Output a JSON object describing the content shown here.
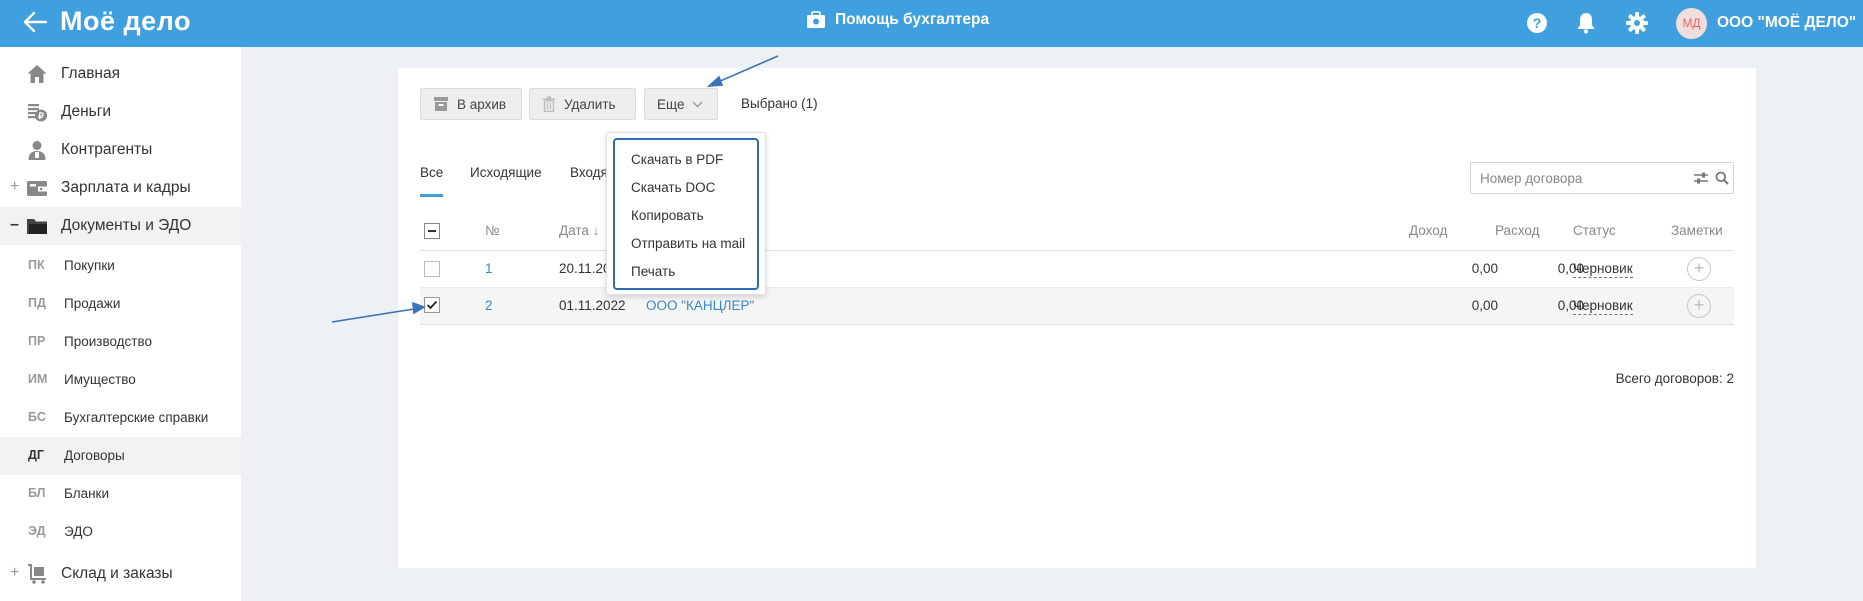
{
  "header": {
    "logo": "Моё дело",
    "help_center": "Помощь бухгалтера",
    "avatar_initials": "МД",
    "org_name": "ООО \"МОЁ ДЕЛО\""
  },
  "sidebar": {
    "items": [
      {
        "label": "Главная",
        "sign": ""
      },
      {
        "label": "Деньги",
        "sign": ""
      },
      {
        "label": "Контрагенты",
        "sign": ""
      },
      {
        "label": "Зарплата и кадры",
        "sign": "+"
      },
      {
        "label": "Документы и ЭДО",
        "sign": "–"
      },
      {
        "label": "Склад и заказы",
        "sign": "+"
      }
    ],
    "subitems": [
      {
        "abbr": "ПК",
        "label": "Покупки"
      },
      {
        "abbr": "ПД",
        "label": "Продажи"
      },
      {
        "abbr": "ПР",
        "label": "Производство"
      },
      {
        "abbr": "ИМ",
        "label": "Имущество"
      },
      {
        "abbr": "БС",
        "label": "Бухгалтерские справки"
      },
      {
        "abbr": "ДГ",
        "label": "Договоры"
      },
      {
        "abbr": "БЛ",
        "label": "Бланки"
      },
      {
        "abbr": "ЭД",
        "label": "ЭДО"
      }
    ]
  },
  "toolbar": {
    "archive_label": "В архив",
    "delete_label": "Удалить",
    "more_label": "Еще",
    "selected_text": "Выбрано (1)"
  },
  "tabs": [
    {
      "label": "Все"
    },
    {
      "label": "Исходящие"
    },
    {
      "label": "Входя"
    }
  ],
  "search": {
    "placeholder": "Номер договора"
  },
  "table": {
    "columns": {
      "number": "№",
      "date": "Дата ↓",
      "income": "Доход",
      "expense": "Расход",
      "status": "Статус",
      "notes": "Заметки"
    },
    "rows": [
      {
        "number": "1",
        "date": "20.11.20",
        "counterparty": "",
        "income": "0,00",
        "expense": "0,00",
        "status": "Черновик",
        "checked": false
      },
      {
        "number": "2",
        "date": "01.11.2022",
        "counterparty": "ООО \"КАНЦЛЕР\"",
        "income": "0,00",
        "expense": "0,00",
        "status": "Черновик",
        "checked": true
      }
    ],
    "total": "Всего договоров: 2"
  },
  "dropdown": {
    "items": [
      {
        "label": "Скачать в PDF"
      },
      {
        "label": "Скачать DOC"
      },
      {
        "label": "Копировать"
      },
      {
        "label": "Отправить на mail"
      },
      {
        "label": "Печать"
      }
    ]
  },
  "colors": {
    "header_bg": "#3f9fdf",
    "link": "#3a89c9",
    "focus_outline": "#2d6bb5",
    "annotation_arrow": "#3b74b8"
  }
}
